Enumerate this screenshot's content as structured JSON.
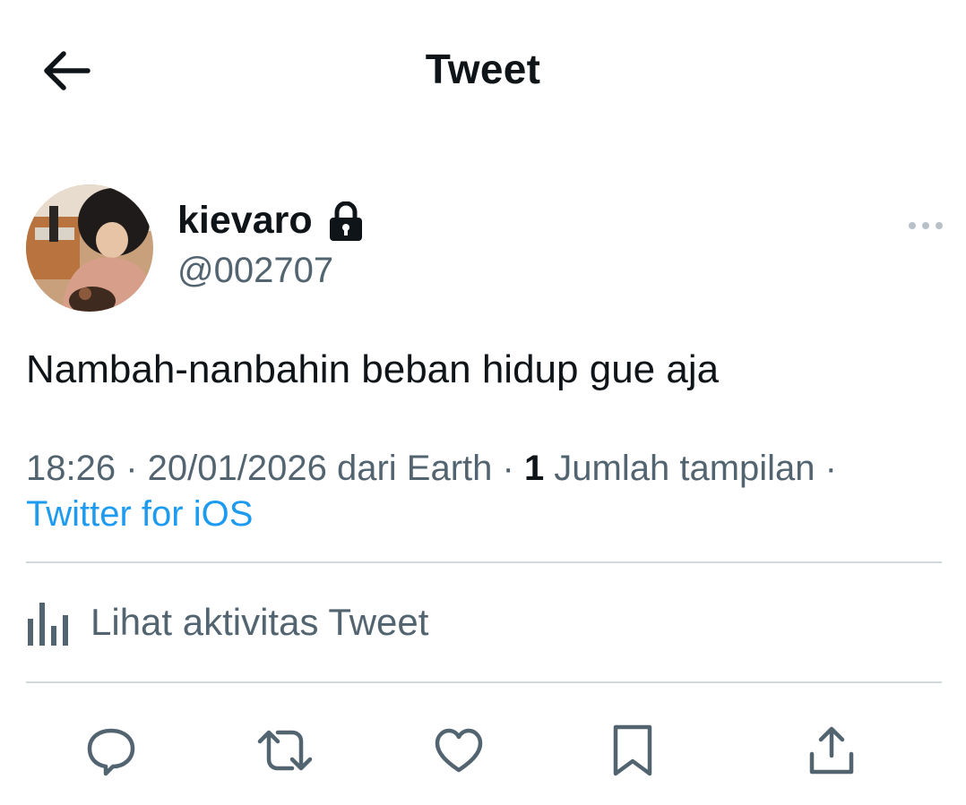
{
  "header": {
    "title": "Tweet",
    "back_icon": "arrow-left-icon"
  },
  "author": {
    "display_name": "kievaro",
    "handle": "@002707",
    "protected_icon": "lock-icon",
    "avatar_icon": "profile-photo"
  },
  "more_icon": "more-horizontal-icon",
  "tweet": {
    "text": "Nambah-nanbahin beban hidup gue aja"
  },
  "meta": {
    "time": "18:26",
    "sep1": " · ",
    "date": "20/01/2026",
    "location": " dari Earth",
    "sep2": " · ",
    "views_count": "1",
    "views_label": " Jumlah tampilan",
    "sep3": " ·",
    "source": "Twitter for iOS"
  },
  "activity": {
    "label": "Lihat aktivitas Tweet",
    "icon": "analytics-bar-icon"
  },
  "actions": [
    {
      "name": "reply",
      "icon": "reply-icon"
    },
    {
      "name": "retweet",
      "icon": "retweet-icon"
    },
    {
      "name": "like",
      "icon": "heart-icon"
    },
    {
      "name": "bookmark",
      "icon": "bookmark-icon"
    },
    {
      "name": "share",
      "icon": "share-icon"
    }
  ],
  "colors": {
    "text_primary": "#0f1419",
    "text_secondary": "#536471",
    "link": "#1d9bf0",
    "divider": "#cfd9de",
    "icon": "#536471"
  }
}
